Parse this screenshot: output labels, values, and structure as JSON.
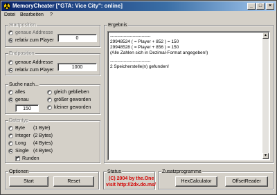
{
  "window": {
    "title": "MemoryCheater [\"GTA: Vice City\": online]"
  },
  "titlebar_buttons": {
    "minimize": "_",
    "maximize": "□",
    "close": "×"
  },
  "menu": [
    "Datei",
    "Bearbeiten",
    "?"
  ],
  "startposition": {
    "legend": "Startposition",
    "opt_absolute": "genaue Addresse",
    "opt_relative": "relativ zum Player",
    "value": "0"
  },
  "endposition": {
    "legend": "Endposition",
    "opt_absolute": "genaue Addresse",
    "opt_relative": "relativ zum Player",
    "value": "1000"
  },
  "search": {
    "legend": "Suche nach...",
    "opt_all": "alles",
    "opt_exact": "genau",
    "opt_same": "gleich geblieben",
    "opt_bigger": "größer geworden",
    "opt_smaller": "kleiner geworden",
    "value": "150"
  },
  "datatype": {
    "legend": "Datentyp",
    "opt_byte": "Byte",
    "opt_byte_size": "(1 Byte)",
    "opt_integer": "Integer",
    "opt_integer_size": "(2 Bytes)",
    "opt_long": "Long",
    "opt_long_size": "(4 Bytes)",
    "opt_single": "Single",
    "opt_single_size": "(4 Bytes)",
    "round": "Runden"
  },
  "result": {
    "legend": "Ergebnis",
    "lines": [
      "---------------------------",
      "29948524 ( = Player + 852 ) = 150",
      "29948528 ( = Player + 856 ) = 150",
      "(Alle Zahlen sich in Dezimal-Format angegeben!)",
      "---------------------------",
      "2 Speicherstelle(n) gefunden!"
    ]
  },
  "options": {
    "legend": "Optionen",
    "start": "Start",
    "reset": "Reset"
  },
  "status": {
    "legend": "Status",
    "line1": "(C) 2004 by the.One",
    "line2": "visit http://2dx.do.ms/"
  },
  "extras": {
    "legend": "Zusatzprogramme",
    "hex": "HexCalculator",
    "offset": "OffsetReader"
  }
}
